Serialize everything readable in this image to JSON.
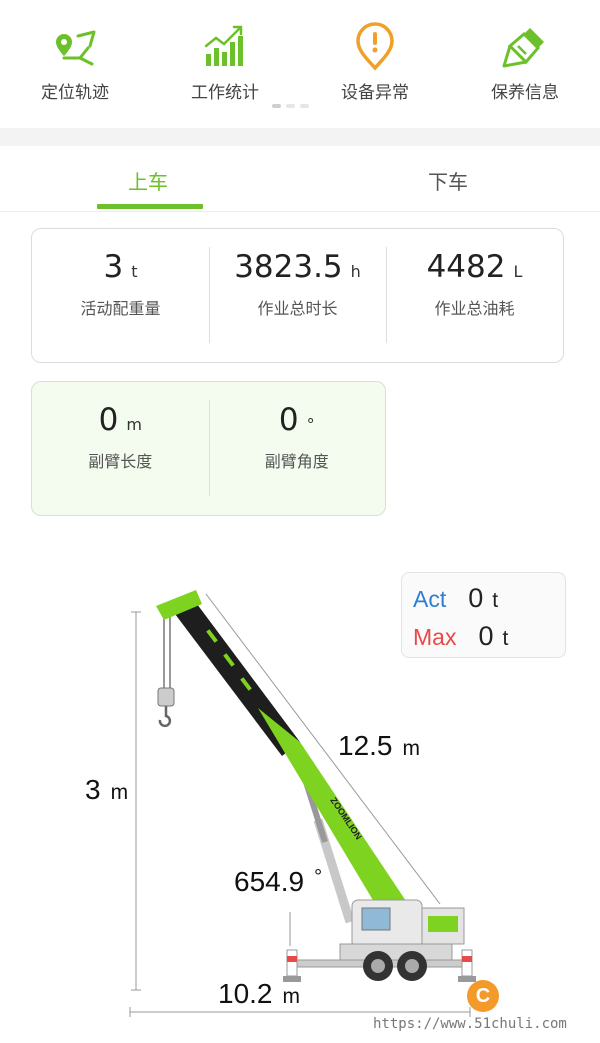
{
  "nav": {
    "items": [
      {
        "label": "定位轨迹",
        "icon": "location-track-icon"
      },
      {
        "label": "工作统计",
        "icon": "bar-chart-icon"
      },
      {
        "label": "设备异常",
        "icon": "alert-icon"
      },
      {
        "label": "保养信息",
        "icon": "brush-icon"
      }
    ],
    "accent": "#6cc12a",
    "alert_color": "#f0a028"
  },
  "tabs": {
    "upper": "上车",
    "lower": "下车",
    "active": "upper"
  },
  "stats": {
    "counterweight": {
      "value": "3",
      "unit": "t",
      "label": "活动配重量"
    },
    "total_hours": {
      "value": "3823.5",
      "unit": "h",
      "label": "作业总时长"
    },
    "total_fuel": {
      "value": "4482",
      "unit": "L",
      "label": "作业总油耗"
    },
    "jib_length": {
      "value": "0",
      "unit": "m",
      "label": "副臂长度"
    },
    "jib_angle": {
      "value": "0",
      "unit": "°",
      "label": "副臂角度"
    }
  },
  "load": {
    "act_label": "Act",
    "act_value": "0",
    "act_unit": "t",
    "max_label": "Max",
    "max_value": "0",
    "max_unit": "t"
  },
  "diagram": {
    "height": {
      "value": "3",
      "unit": "m"
    },
    "boom_length": {
      "value": "12.5",
      "unit": "m"
    },
    "boom_angle": {
      "value": "654.9",
      "unit": "°"
    },
    "radius": {
      "value": "10.2",
      "unit": "m"
    },
    "brand": "ZOOMLION"
  },
  "badge": "C",
  "watermark": "https://www.51chuli.com"
}
